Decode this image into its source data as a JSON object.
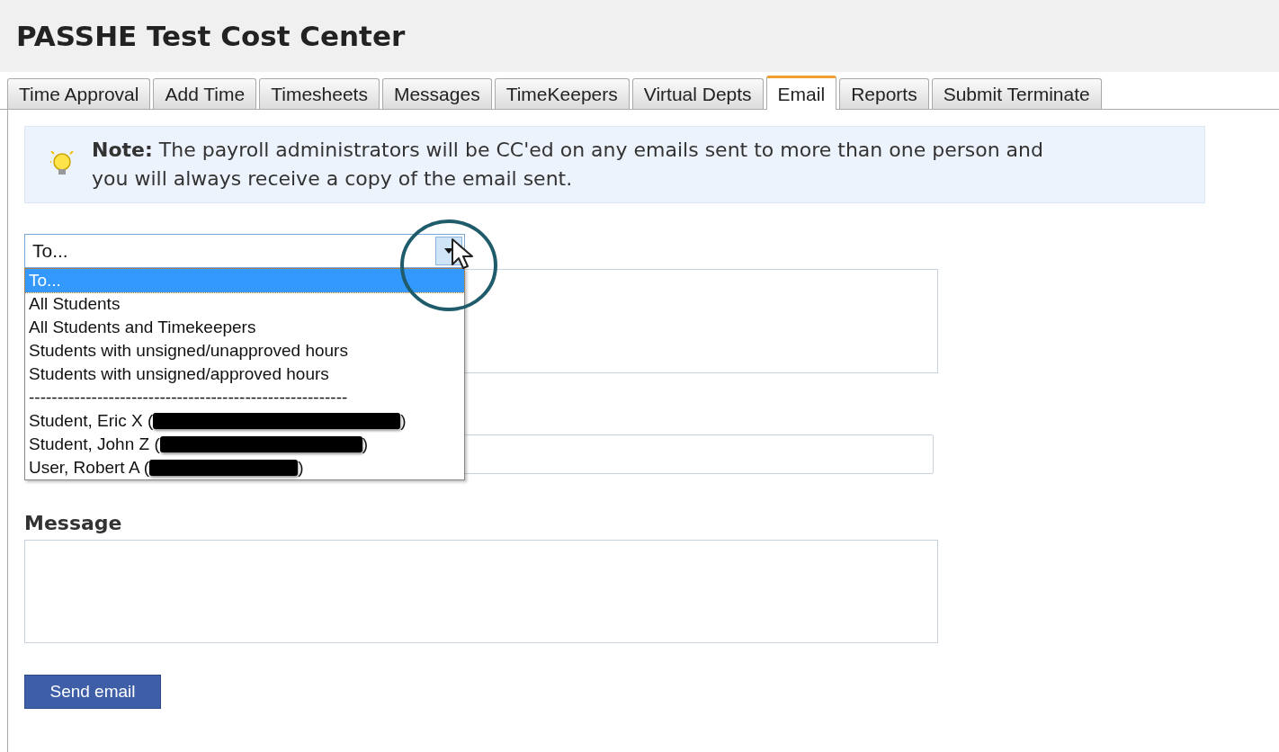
{
  "title": "PASSHE Test Cost Center",
  "tabs": [
    {
      "label": "Time Approval",
      "selected": false
    },
    {
      "label": "Add Time",
      "selected": false
    },
    {
      "label": "Timesheets",
      "selected": false
    },
    {
      "label": "Messages",
      "selected": false
    },
    {
      "label": "TimeKeepers",
      "selected": false
    },
    {
      "label": "Virtual Depts",
      "selected": false
    },
    {
      "label": "Email",
      "selected": true
    },
    {
      "label": "Reports",
      "selected": false
    },
    {
      "label": "Submit Terminate",
      "selected": false
    }
  ],
  "note": {
    "text": "**Note:** The payroll administrators will be CC'ed on any emails sent to more than one person and you will always receive a copy of the email sent."
  },
  "recipient_select": {
    "value": "To...",
    "expanded": true,
    "options": [
      {
        "kind": "option",
        "label": "To...",
        "selected": true
      },
      {
        "kind": "option",
        "label": "All Students",
        "selected": false
      },
      {
        "kind": "option",
        "label": "All Students and Timekeepers",
        "selected": false
      },
      {
        "kind": "option",
        "label": "Students with unsigned/unapproved hours",
        "selected": false
      },
      {
        "kind": "option",
        "label": "Students with unsigned/approved hours",
        "selected": false
      },
      {
        "kind": "separator",
        "label": "--------------------------------------------------------",
        "selected": false
      },
      {
        "kind": "contact",
        "label": "Student, Eric X (",
        "suffix": ")",
        "selected": false
      },
      {
        "kind": "contact",
        "label": "Student, John Z (",
        "suffix": ")",
        "selected": false
      },
      {
        "kind": "contact",
        "label": "User, Robert A (",
        "suffix": ")",
        "selected": false
      }
    ]
  },
  "message": {
    "label": "Message"
  },
  "send_button": {
    "label": "Send email"
  }
}
